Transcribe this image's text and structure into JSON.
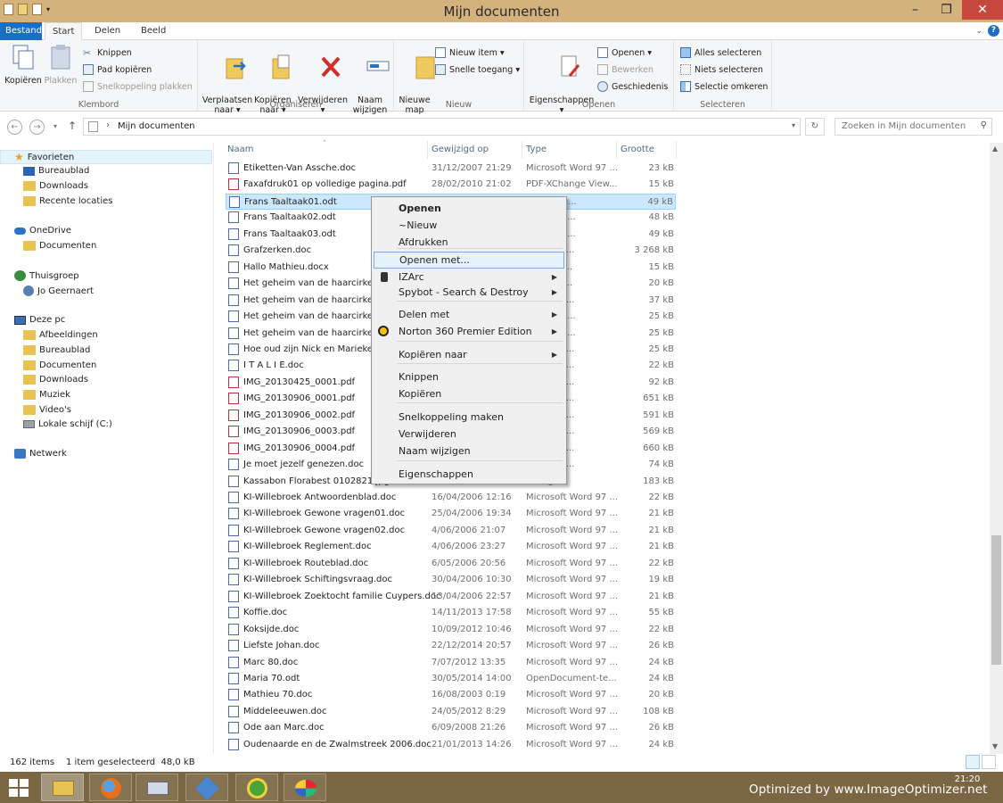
{
  "window": {
    "title": "Mijn documenten",
    "controls": [
      "–",
      "❐",
      "✕"
    ]
  },
  "ribbon_tabs": [
    "Bestand",
    "Start",
    "Delen",
    "Beeld"
  ],
  "ribbon": {
    "clipboard": {
      "label": "Klembord",
      "copy": "Kopiëren",
      "paste": "Plakken",
      "cut": "Knippen",
      "copy_path": "Pad kopiëren",
      "paste_shortcut": "Snelkoppeling plakken"
    },
    "organize": {
      "label": "Organiseren",
      "move_to": "Verplaatsen\nnaar ▾",
      "copy_to": "Kopiëren\nnaar ▾",
      "delete": "Verwijderen\n▾",
      "rename": "Naam\nwijzigen"
    },
    "new": {
      "label": "Nieuw",
      "new_folder": "Nieuwe\nmap",
      "new_item": "Nieuw item ▾",
      "easy_access": "Snelle toegang ▾"
    },
    "open": {
      "label": "Openen",
      "properties": "Eigenschappen\n▾",
      "open": "Openen ▾",
      "edit": "Bewerken",
      "history": "Geschiedenis"
    },
    "select": {
      "label": "Selecteren",
      "select_all": "Alles selecteren",
      "select_none": "Niets selecteren",
      "invert": "Selectie omkeren"
    }
  },
  "address": {
    "path": "Mijn documenten",
    "search_placeholder": "Zoeken in Mijn documenten"
  },
  "nav": {
    "favorites": "Favorieten",
    "fav_items": [
      "Bureaublad",
      "Downloads",
      "Recente locaties"
    ],
    "onedrive": "OneDrive",
    "onedrive_items": [
      "Documenten"
    ],
    "homegroup": "Thuisgroep",
    "homegroup_items": [
      "Jo Geernaert"
    ],
    "thispc": "Deze pc",
    "pc_items": [
      "Afbeeldingen",
      "Bureaublad",
      "Documenten",
      "Downloads",
      "Muziek",
      "Video's",
      "Lokale schijf (C:)"
    ],
    "network": "Netwerk"
  },
  "columns": {
    "name": "Naam",
    "modified": "Gewijzigd op",
    "type": "Type",
    "size": "Grootte"
  },
  "files": [
    {
      "name": "Etiketten-Van Assche.doc",
      "date": "31/12/2007 21:29",
      "type": "Microsoft Word 97 ...",
      "size": "23 kB"
    },
    {
      "name": "Faxafdruk01 op volledige pagina.pdf",
      "date": "28/02/2010 21:02",
      "type": "PDF-XChange View...",
      "size": "15 kB"
    },
    {
      "name": "Frans Taaltaak01.odt",
      "date": "",
      "type": "ument-te...",
      "size": "49 kB"
    },
    {
      "name": "Frans Taaltaak02.odt",
      "date": "",
      "type": "ument-te...",
      "size": "48 kB"
    },
    {
      "name": "Frans Taaltaak03.odt",
      "date": "",
      "type": "ument-te...",
      "size": "49 kB"
    },
    {
      "name": "Grafzerken.doc",
      "date": "",
      "type": "Word 97 ...",
      "size": "3 268 kB"
    },
    {
      "name": "Hallo Mathieu.docx",
      "date": "",
      "type": "Word Do...",
      "size": "15 kB"
    },
    {
      "name": "Het geheim van de haarcirkels.c",
      "date": "",
      "type": "Word Do...",
      "size": "20 kB"
    },
    {
      "name": "Het geheim van de haarcirkels.pc",
      "date": "",
      "type": "nge View...",
      "size": "37 kB"
    },
    {
      "name": "Het geheim van de haarcirkels0",
      "date": "",
      "type": "ument-te...",
      "size": "25 kB"
    },
    {
      "name": "Het geheim van de haarcirkels0",
      "date": "",
      "type": "ument-te...",
      "size": "25 kB"
    },
    {
      "name": "Hoe oud zijn Nick en Marieke.d",
      "date": "",
      "type": "Word 97 ...",
      "size": "25 kB"
    },
    {
      "name": "I T A L I E.doc",
      "date": "",
      "type": "Word 97 ...",
      "size": "22 kB"
    },
    {
      "name": "IMG_20130425_0001.pdf",
      "date": "",
      "type": "nge View...",
      "size": "92 kB"
    },
    {
      "name": "IMG_20130906_0001.pdf",
      "date": "",
      "type": "nge View...",
      "size": "651 kB"
    },
    {
      "name": "IMG_20130906_0002.pdf",
      "date": "",
      "type": "nge View...",
      "size": "591 kB"
    },
    {
      "name": "IMG_20130906_0003.pdf",
      "date": "",
      "type": "nge View...",
      "size": "569 kB"
    },
    {
      "name": "IMG_20130906_0004.pdf",
      "date": "",
      "type": "nge View...",
      "size": "660 kB"
    },
    {
      "name": "Je moet jezelf genezen.doc",
      "date": "",
      "type": "Word 97 ...",
      "size": "74 kB"
    },
    {
      "name": "Kassabon Florabest 0102821.jpg",
      "date": "",
      "type": "elding",
      "size": "183 kB"
    },
    {
      "name": "KI-Willebroek Antwoordenblad.doc",
      "date": "16/04/2006 12:16",
      "type": "Microsoft Word 97 ...",
      "size": "22 kB"
    },
    {
      "name": "KI-Willebroek Gewone vragen01.doc",
      "date": "25/04/2006 19:34",
      "type": "Microsoft Word 97 ...",
      "size": "21 kB"
    },
    {
      "name": "KI-Willebroek Gewone vragen02.doc",
      "date": "4/06/2006 21:07",
      "type": "Microsoft Word 97 ...",
      "size": "21 kB"
    },
    {
      "name": "KI-Willebroek Reglement.doc",
      "date": "4/06/2006 23:27",
      "type": "Microsoft Word 97 ...",
      "size": "21 kB"
    },
    {
      "name": "KI-Willebroek Routeblad.doc",
      "date": "6/05/2006 20:56",
      "type": "Microsoft Word 97 ...",
      "size": "22 kB"
    },
    {
      "name": "KI-Willebroek Schiftingsvraag.doc",
      "date": "30/04/2006 10:30",
      "type": "Microsoft Word 97 ...",
      "size": "19 kB"
    },
    {
      "name": "KI-Willebroek Zoektocht familie Cuypers.doc",
      "date": "13/04/2006 22:57",
      "type": "Microsoft Word 97 ...",
      "size": "21 kB"
    },
    {
      "name": "Koffie.doc",
      "date": "14/11/2013 17:58",
      "type": "Microsoft Word 97 ...",
      "size": "55 kB"
    },
    {
      "name": "Koksijde.doc",
      "date": "10/09/2012 10:46",
      "type": "Microsoft Word 97 ...",
      "size": "22 kB"
    },
    {
      "name": "Liefste Johan.doc",
      "date": "22/12/2014 20:57",
      "type": "Microsoft Word 97 ...",
      "size": "26 kB"
    },
    {
      "name": "Marc 80.doc",
      "date": "7/07/2012 13:35",
      "type": "Microsoft Word 97 ...",
      "size": "24 kB"
    },
    {
      "name": "Maria 70.odt",
      "date": "30/05/2014 14:00",
      "type": "OpenDocument-te...",
      "size": "24 kB"
    },
    {
      "name": "Mathieu 70.doc",
      "date": "16/08/2003 0:19",
      "type": "Microsoft Word 97 ...",
      "size": "20 kB"
    },
    {
      "name": "Middeleeuwen.doc",
      "date": "24/05/2012 8:29",
      "type": "Microsoft Word 97 ...",
      "size": "108 kB"
    },
    {
      "name": "Ode aan Marc.doc",
      "date": "6/09/2008 21:26",
      "type": "Microsoft Word 97 ...",
      "size": "26 kB"
    },
    {
      "name": "Oudenaarde en de Zwalmstreek 2006.doc",
      "date": "21/01/2013 14:26",
      "type": "Microsoft Word 97 ...",
      "size": "24 kB"
    }
  ],
  "context_menu": {
    "items": [
      "Openen",
      "~Nieuw",
      "Afdrukken",
      "Openen met...",
      "IZArc",
      "Spybot - Search & Destroy",
      "Delen met",
      "Norton 360 Premier Edition",
      "Kopiëren naar",
      "Knippen",
      "Kopiëren",
      "Snelkoppeling maken",
      "Verwijderen",
      "Naam wijzigen",
      "Eigenschappen"
    ]
  },
  "status": {
    "count": "162 items",
    "selection": "1 item geselecteerd  48,0 kB"
  },
  "taskbar": {
    "clock_time": "21:20"
  },
  "watermark": "Optimized by www.ImageOptimizer.net",
  "colors": {
    "title": "#d3b27c",
    "taskbar": "#7a6643",
    "accent": "#1a6fc4",
    "selection": "#cce8ff"
  }
}
